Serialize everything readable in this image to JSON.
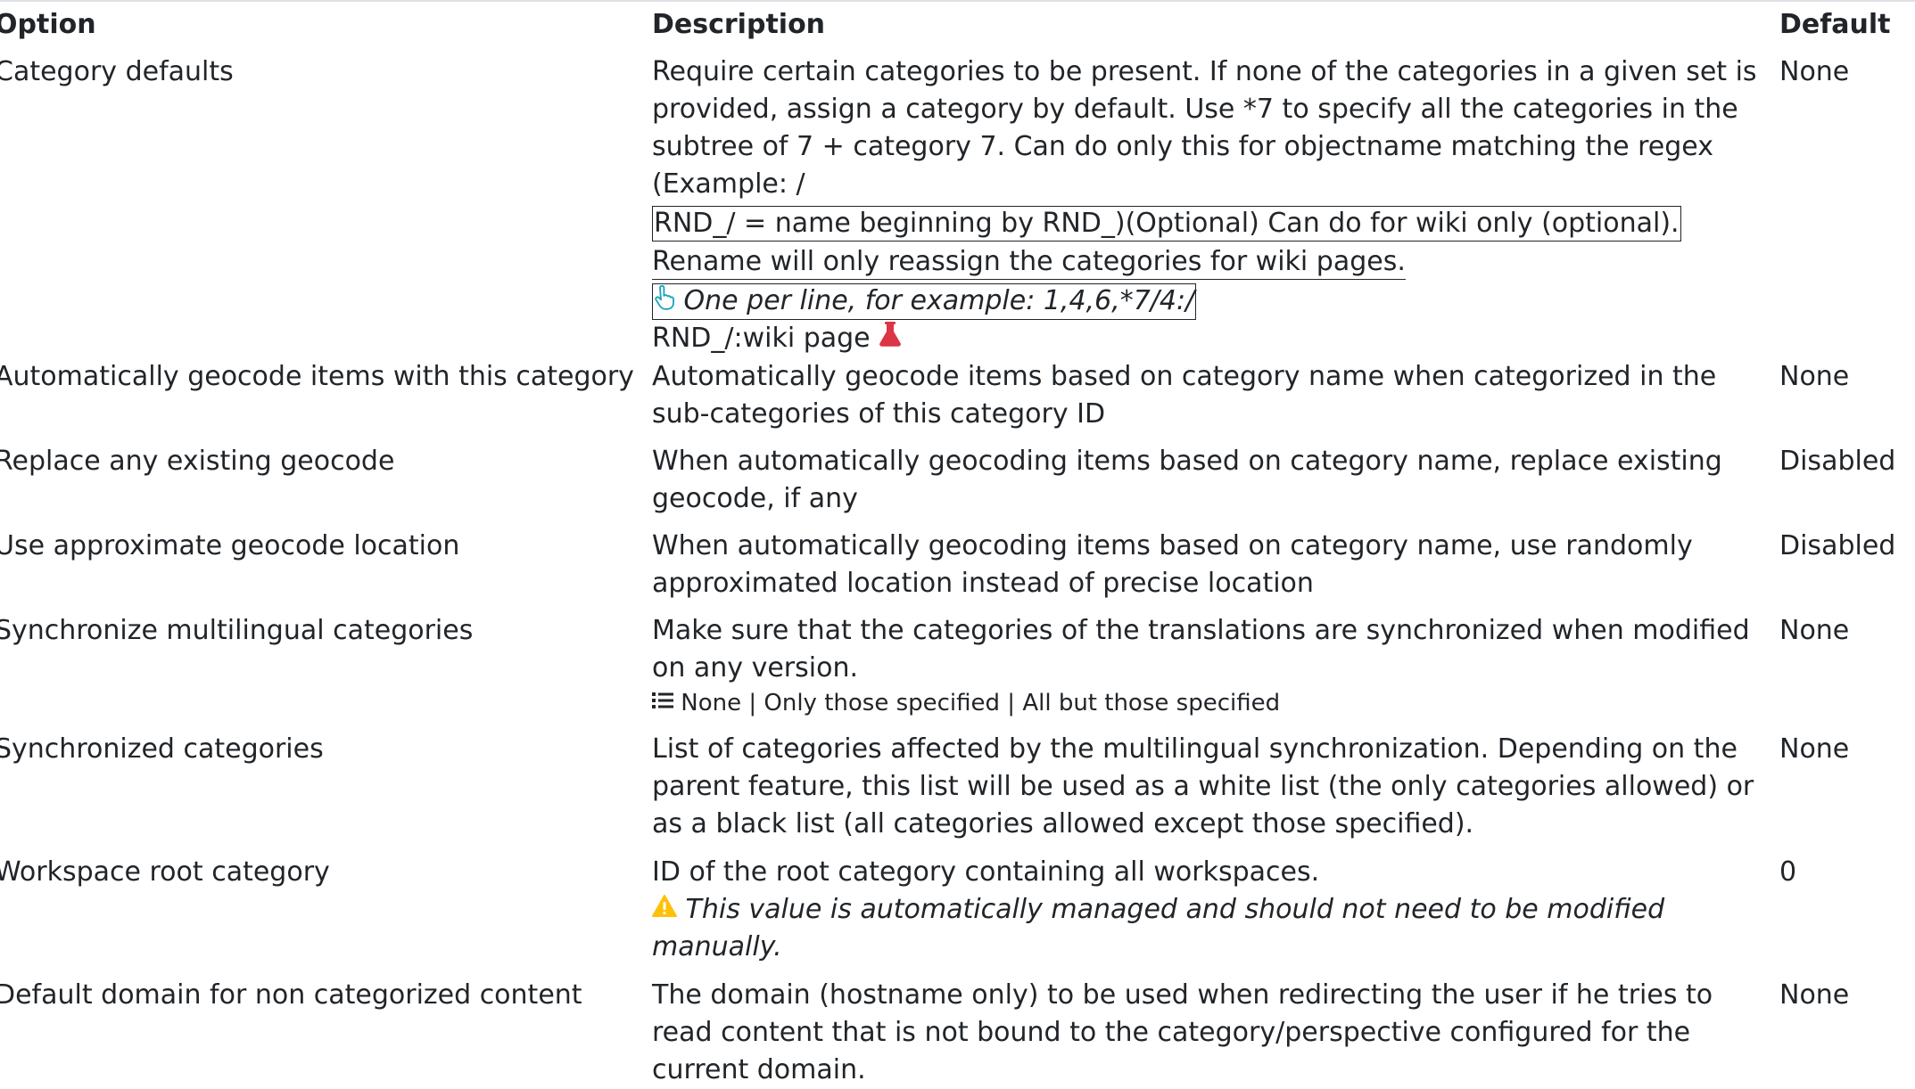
{
  "table": {
    "headers": {
      "option": "Option",
      "description": "Description",
      "default": "Default"
    },
    "rows": [
      {
        "option": "Category defaults",
        "description": {
          "line1": "Require certain categories to be present. If none of the categories in a given set is",
          "line2": "provided, assign a category by default. Use *7 to specify all the categories in the",
          "line3": "subtree of 7 + category 7. Can do only this for objectname matching the regex",
          "line4": "(Example: /",
          "line5": "RND_/ = name beginning by RND_)(Optional) Can do for wiki only (optional).",
          "line6": "Rename will only reassign the categories for wiki pages.",
          "hint": "One per line, for example: 1,4,6,*7/4:/",
          "line8": "RND_/:wiki page"
        },
        "default": "None"
      },
      {
        "option": "Automatically geocode items with this category",
        "description": {
          "line1": "Automatically geocode items based on category name when categorized in the",
          "line2": "sub-categories of this category ID"
        },
        "default": "None"
      },
      {
        "option": "Replace any existing geocode",
        "description": {
          "line1": "When automatically geocoding items based on category name, replace existing",
          "line2": "geocode, if any"
        },
        "default": "Disabled"
      },
      {
        "option": "Use approximate geocode location",
        "description": {
          "line1": "When automatically geocoding items based on category name, use randomly",
          "line2": "approximated location instead of precise location"
        },
        "default": "Disabled"
      },
      {
        "option": "Synchronize multilingual categories",
        "description": {
          "line1": "Make sure that the categories of the translations are synchronized when modified",
          "line2": "on any version.",
          "options": "None | Only those specified | All but those specified"
        },
        "default": "None"
      },
      {
        "option": "Synchronized categories",
        "description": {
          "line1": "List of categories affected by the multilingual synchronization. Depending on the",
          "line2": "parent feature, this list will be used as a white list (the only categories allowed) or",
          "line3": "as a black list (all categories allowed except those specified)."
        },
        "default": "None"
      },
      {
        "option": "Workspace root category",
        "description": {
          "line1": "ID of the root category containing all workspaces.",
          "warning1": "This value is automatically managed and should not need to be modified",
          "warning2": "manually."
        },
        "default": "0"
      },
      {
        "option": "Default domain for non categorized content",
        "description": {
          "line1": "The domain (hostname only) to be used when redirecting the user if he tries to",
          "line2": "read content that is not bound to the category/perspective configured for the",
          "line3": "current domain."
        },
        "default": "None"
      }
    ]
  },
  "icons": {
    "hint": "pointing-hand-icon",
    "experimental": "flask-icon",
    "list": "list-icon",
    "warning": "warning-icon"
  },
  "colors": {
    "hint_icon": "#17a2b8",
    "flask_icon": "#dc3545",
    "warning_icon": "#ffc107",
    "text": "#212529"
  }
}
